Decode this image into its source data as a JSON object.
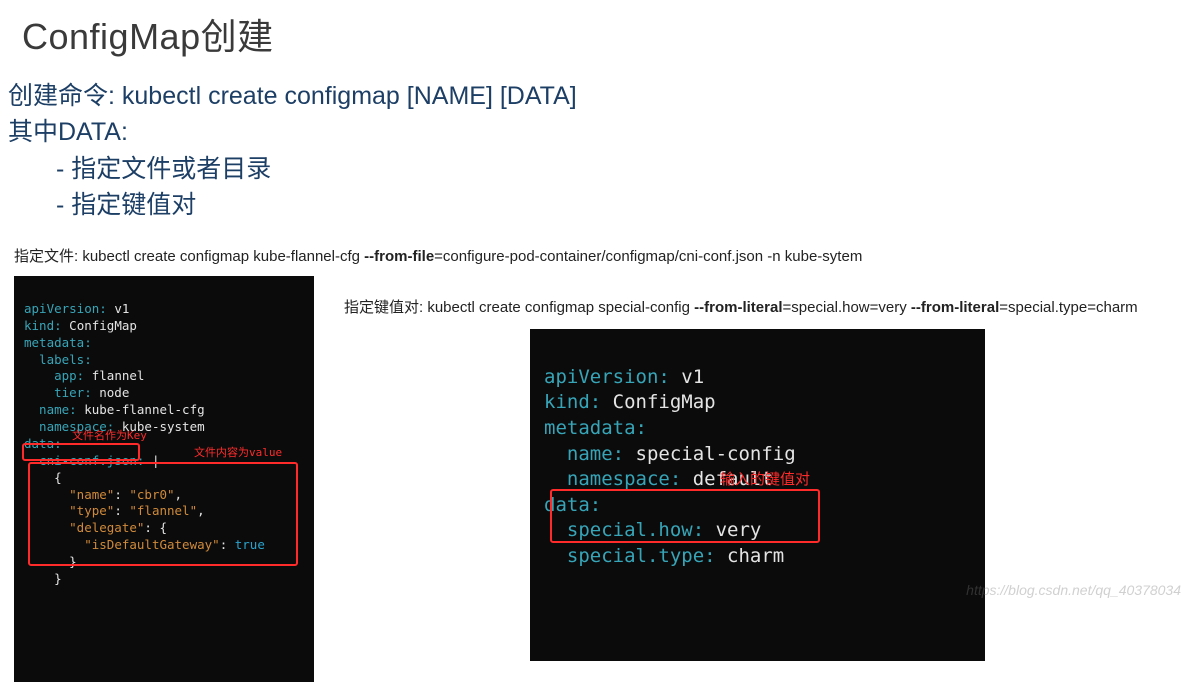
{
  "title": "ConfigMap创建",
  "intro": {
    "line1_label": "创建命令: ",
    "line1_cmd": "kubectl create configmap [NAME] [DATA]",
    "line2": "其中DATA:",
    "bullet1": "- 指定文件或者目录",
    "bullet2": "- 指定键值对"
  },
  "example_file": {
    "caption_prefix": "指定文件: kubectl create configmap kube-flannel-cfg  ",
    "caption_bold": "--from-file",
    "caption_suffix": "=configure-pod-container/configmap/cni-conf.json -n kube-sytem",
    "yaml": {
      "apiVersion_k": "apiVersion:",
      "apiVersion_v": " v1",
      "kind_k": "kind:",
      "kind_v": " ConfigMap",
      "metadata_k": "metadata:",
      "labels_k": "  labels:",
      "app_k": "    app:",
      "app_v": " flannel",
      "tier_k": "    tier:",
      "tier_v": " node",
      "name_k": "  name:",
      "name_v": " kube-flannel-cfg",
      "namespace_k": "  namespace:",
      "namespace_v": " kube-system",
      "data_k": "data:",
      "cni_k": "  cni-conf.json:",
      "cni_v": " |",
      "json_l1": "    {",
      "json_name_k": "\"name\"",
      "json_name_v": "\"cbr0\"",
      "json_type_k": "\"type\"",
      "json_type_v": "\"flannel\"",
      "json_delegate_k": "\"delegate\"",
      "json_gw_k": "\"isDefaultGateway\"",
      "json_gw_v": "true",
      "json_close1": "      }",
      "json_close2": "    }"
    },
    "note_key": "文件名作为Key",
    "note_value": "文件内容为value"
  },
  "example_literal": {
    "caption_prefix": "指定键值对: kubectl create configmap special-config ",
    "caption_bold1": "--from-literal",
    "caption_mid": "=special.how=very ",
    "caption_bold2": "--from-literal",
    "caption_suffix": "=special.type=charm",
    "yaml": {
      "apiVersion_k": "apiVersion:",
      "apiVersion_v": " v1",
      "kind_k": "kind:",
      "kind_v": " ConfigMap",
      "metadata_k": "metadata:",
      "name_k": "  name:",
      "name_v": " special-config",
      "namespace_k": "  namespace:",
      "namespace_v": " default",
      "data_k": "data:",
      "k1_k": "  special.how:",
      "k1_v": " very",
      "k2_k": "  special.type:",
      "k2_v": " charm"
    },
    "note": "输入的键值对"
  },
  "watermark": "https://blog.csdn.net/qq_40378034"
}
